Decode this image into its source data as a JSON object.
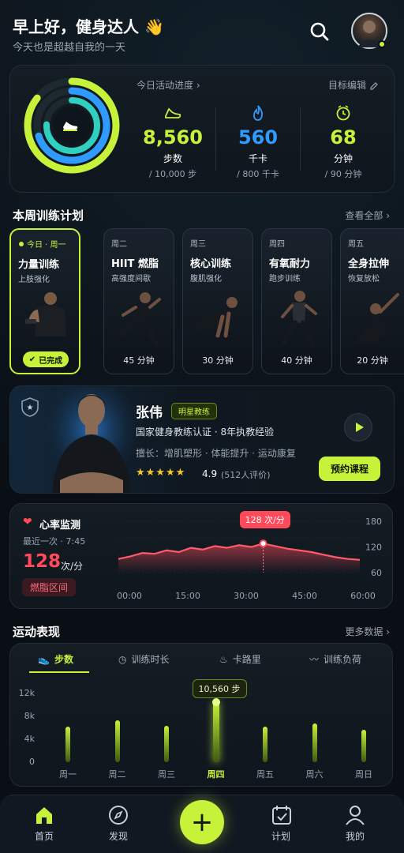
{
  "header": {
    "greeting": "早上好，健身达人 👋",
    "subtitle": "今天也是超越自我的一天"
  },
  "activity": {
    "title": "今日活动进度 ›",
    "edit": "目标编辑",
    "steps": {
      "value": "8,560",
      "label": "步数",
      "goal": "/ 10,000 步",
      "progress": 0.856
    },
    "calories": {
      "value": "560",
      "label": "千卡",
      "goal": "/ 800 千卡",
      "progress": 0.7
    },
    "minutes": {
      "value": "68",
      "label": "分钟",
      "goal": "/ 90 分钟",
      "progress": 0.756
    }
  },
  "plan": {
    "title": "本周训练计划",
    "view_all": "查看全部 ›",
    "days": [
      {
        "day": "今日 · 周一",
        "name": "力量训练",
        "sub": "上肢强化",
        "status": "已完成"
      },
      {
        "day": "周二",
        "name": "HIIT 燃脂",
        "sub": "高强度间歇",
        "duration": "45 分钟"
      },
      {
        "day": "周三",
        "name": "核心训练",
        "sub": "腹肌强化",
        "duration": "30 分钟"
      },
      {
        "day": "周四",
        "name": "有氧耐力",
        "sub": "跑步训练",
        "duration": "40 分钟"
      },
      {
        "day": "周五",
        "name": "全身拉伸",
        "sub": "恢复放松",
        "duration": "20 分钟"
      }
    ]
  },
  "coach": {
    "name": "张伟",
    "badge": "明星教练",
    "cert": "国家健身教练认证 · 8年执教经验",
    "skills": "擅长：增肌塑形 · 体能提升 · 运动康复",
    "rating": "4.9",
    "reviews": "(512人评价)",
    "book": "预约课程"
  },
  "heart": {
    "title": "心率监测",
    "last": "最近一次 · 7:45",
    "bpm": "128",
    "unit": "次/分",
    "zone": "燃脂区间",
    "tooltip": "128 次/分",
    "y_ticks": [
      "180",
      "120",
      "60"
    ],
    "x_ticks": [
      "00:00",
      "15:00",
      "30:00",
      "45:00",
      "60:00"
    ]
  },
  "chart_data": {
    "type": "area",
    "x": [
      0,
      3,
      6,
      9,
      12,
      15,
      18,
      21,
      24,
      27,
      30,
      33,
      36,
      39,
      42,
      45,
      48,
      51,
      54,
      57,
      60
    ],
    "y": [
      92,
      98,
      106,
      104,
      112,
      108,
      118,
      114,
      122,
      118,
      124,
      120,
      128,
      122,
      116,
      112,
      108,
      102,
      96,
      92,
      90
    ],
    "ylim": [
      60,
      180
    ],
    "xlim": [
      0,
      60
    ],
    "highlight": {
      "x": 36,
      "y": 128
    }
  },
  "performance": {
    "title": "运动表现",
    "more": "更多数据 ›",
    "tabs": [
      "步数",
      "训练时长",
      "卡路里",
      "训练负荷"
    ],
    "y_ticks": [
      "12k",
      "8k",
      "4k",
      "0"
    ],
    "days": [
      "周一",
      "周二",
      "周三",
      "周四",
      "周五",
      "周六",
      "周日"
    ],
    "values": [
      6200,
      7300,
      6300,
      10560,
      6200,
      6700,
      5600
    ],
    "tooltip": "10,560 步",
    "selected": 3
  },
  "nav": {
    "items": [
      "首页",
      "发现",
      "计划",
      "我的"
    ]
  },
  "colors": {
    "accent": "#c6f23a",
    "blue": "#2f9bff",
    "heart": "#ff4a5c"
  }
}
